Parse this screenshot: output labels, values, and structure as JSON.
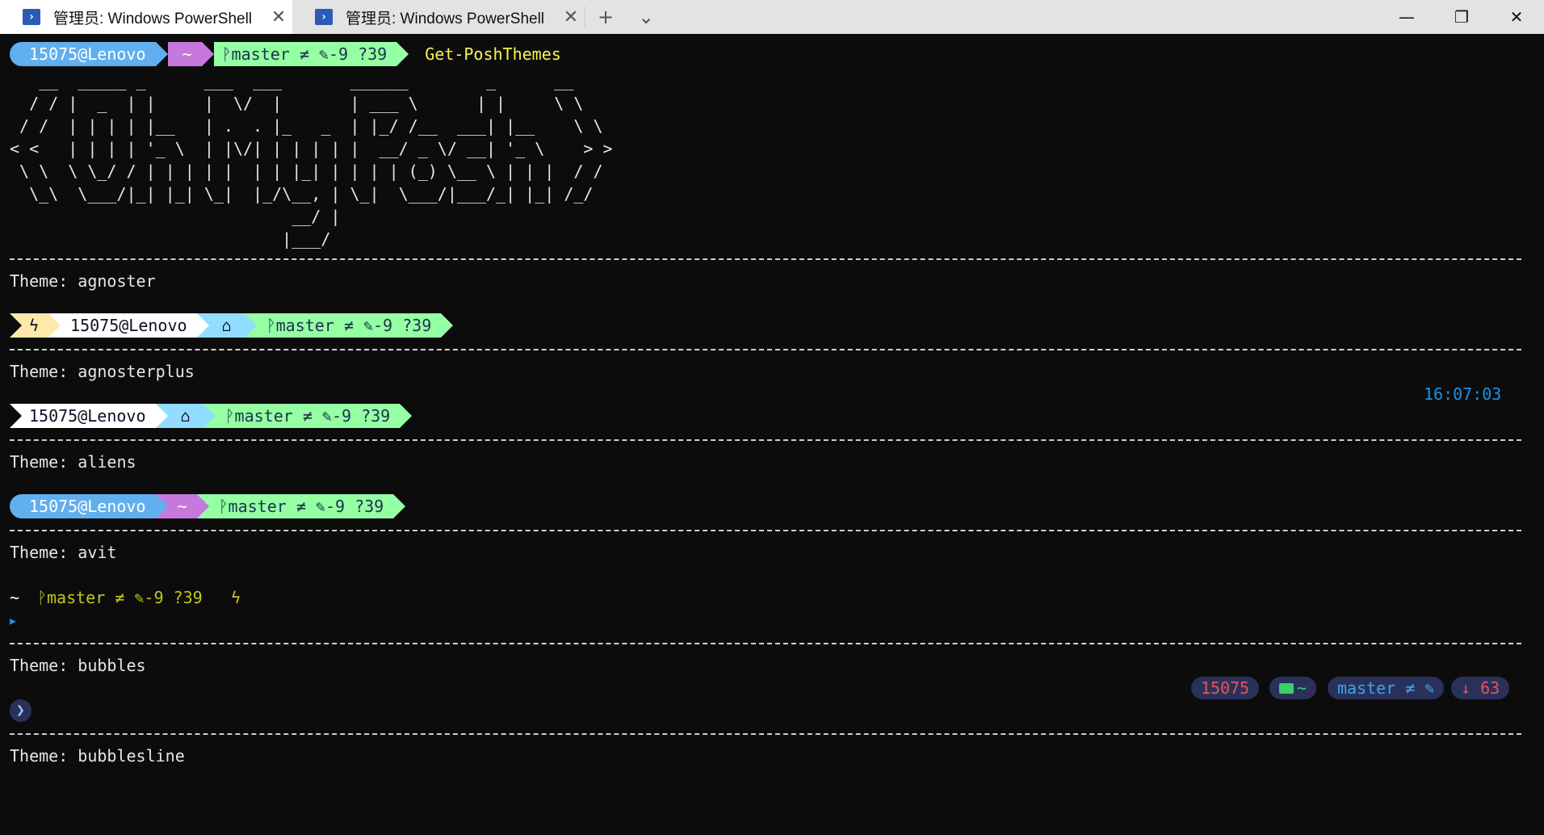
{
  "window": {
    "tabs": [
      {
        "label": "管理员: Windows PowerShell",
        "active": true
      },
      {
        "label": "管理员: Windows PowerShell",
        "active": false
      }
    ],
    "new_tab_glyph": "+",
    "dropdown_glyph": "⌄",
    "minimize_glyph": "—",
    "restore_glyph": "❐",
    "close_glyph": "✕"
  },
  "prompt": {
    "user": "15075@Lenovo",
    "home": "~",
    "git": "ᚹmaster ≠ ✎-9 ?39",
    "command": "Get-PoshThemes"
  },
  "ascii_art": "   __  _____ _      ___  ___       ______        _      __\n  / / |  _  | |     |  \\/  |       | ___ \\      | |     \\ \\\n / /  | | | | |__   | .  . |_   _  | |_/ /__  ___| |__    \\ \\\n< <   | | | | '_ \\  | |\\/| | | | | |  __/ _ \\/ __| '_ \\    > >\n \\ \\  \\ \\_/ / | | | | |  | | |_| | | | | (_) \\__ \\ | | |  / /\n  \\_\\  \\___/|_| |_| \\_|  |_/\\__, | \\_|  \\___/|___/_| |_| /_/\n                             __/ |\n                            |___/",
  "themes": [
    {
      "label": "Theme: agnoster"
    },
    {
      "label": "Theme: agnosterplus"
    },
    {
      "label": "Theme: aliens"
    },
    {
      "label": "Theme: avit"
    },
    {
      "label": "Theme: bubbles"
    },
    {
      "label": "Theme: bubblesline"
    }
  ],
  "agnoster": {
    "bolt": "ϟ",
    "user": "15075@Lenovo",
    "home": "⌂",
    "git": "ᚹmaster ≠ ✎-9 ?39"
  },
  "agnosterplus": {
    "user": "15075@Lenovo",
    "home": "⌂",
    "git": "ᚹmaster ≠ ✎-9 ?39",
    "time": "16:07:03"
  },
  "aliens": {
    "user": "15075@Lenovo",
    "home": "~",
    "git": "ᚹmaster ≠ ✎-9 ?39"
  },
  "avit": {
    "path": "~",
    "git": "ᚹmaster ≠ ✎-9 ?39",
    "bolt": "ϟ",
    "cursor": "▸"
  },
  "bubbles": {
    "user": "15075",
    "path": "~",
    "git": "master ≠ ✎",
    "behind": "↓ 63",
    "prompt_char": "❯"
  },
  "colors": {
    "background": "#0c0c0c",
    "blue": "#61afef",
    "purple": "#c678dd",
    "green": "#95ffa4",
    "command": "#f9f54f"
  }
}
